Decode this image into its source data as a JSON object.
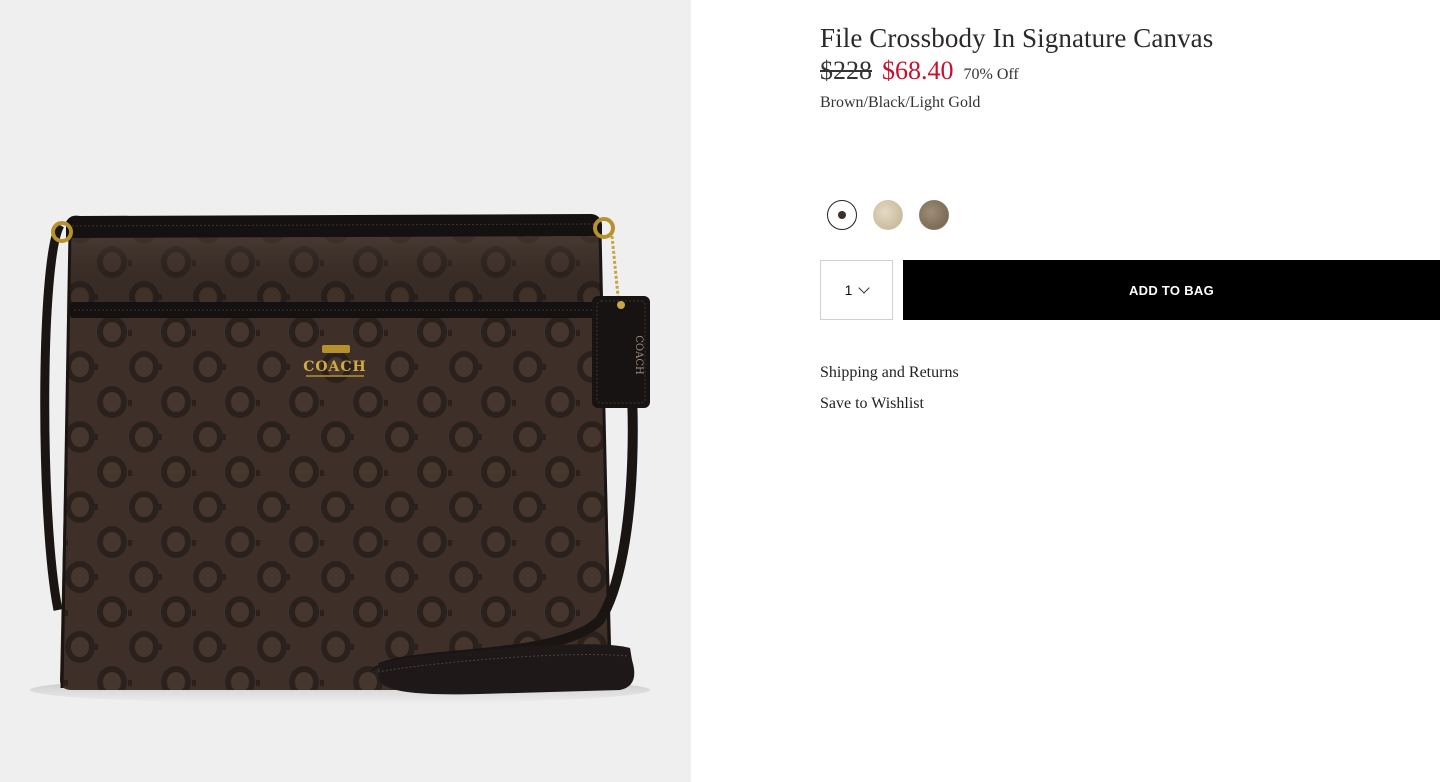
{
  "product": {
    "title": "File Crossbody In Signature Canvas",
    "original_price": "$228",
    "sale_price": "$68.40",
    "discount": "70% Off",
    "color_name": "Brown/Black/Light Gold",
    "image_logo_text": "COACH",
    "tag_logo_text": "COACH"
  },
  "swatches": [
    {
      "name": "Brown/Black/Light Gold",
      "selected": true,
      "color": "#3c2f2a"
    },
    {
      "name": "khaki",
      "selected": false,
      "color": "#cbbd9f"
    },
    {
      "name": "taupe",
      "selected": false,
      "color": "#7d6c59"
    }
  ],
  "quantity": {
    "value": "1"
  },
  "actions": {
    "add_to_bag_label": "ADD TO BAG",
    "shipping_label": "Shipping and Returns",
    "wishlist_label": "Save to Wishlist"
  },
  "colors": {
    "sale_price": "#c8102e",
    "button_bg": "#000000",
    "image_bg": "#efefef"
  }
}
